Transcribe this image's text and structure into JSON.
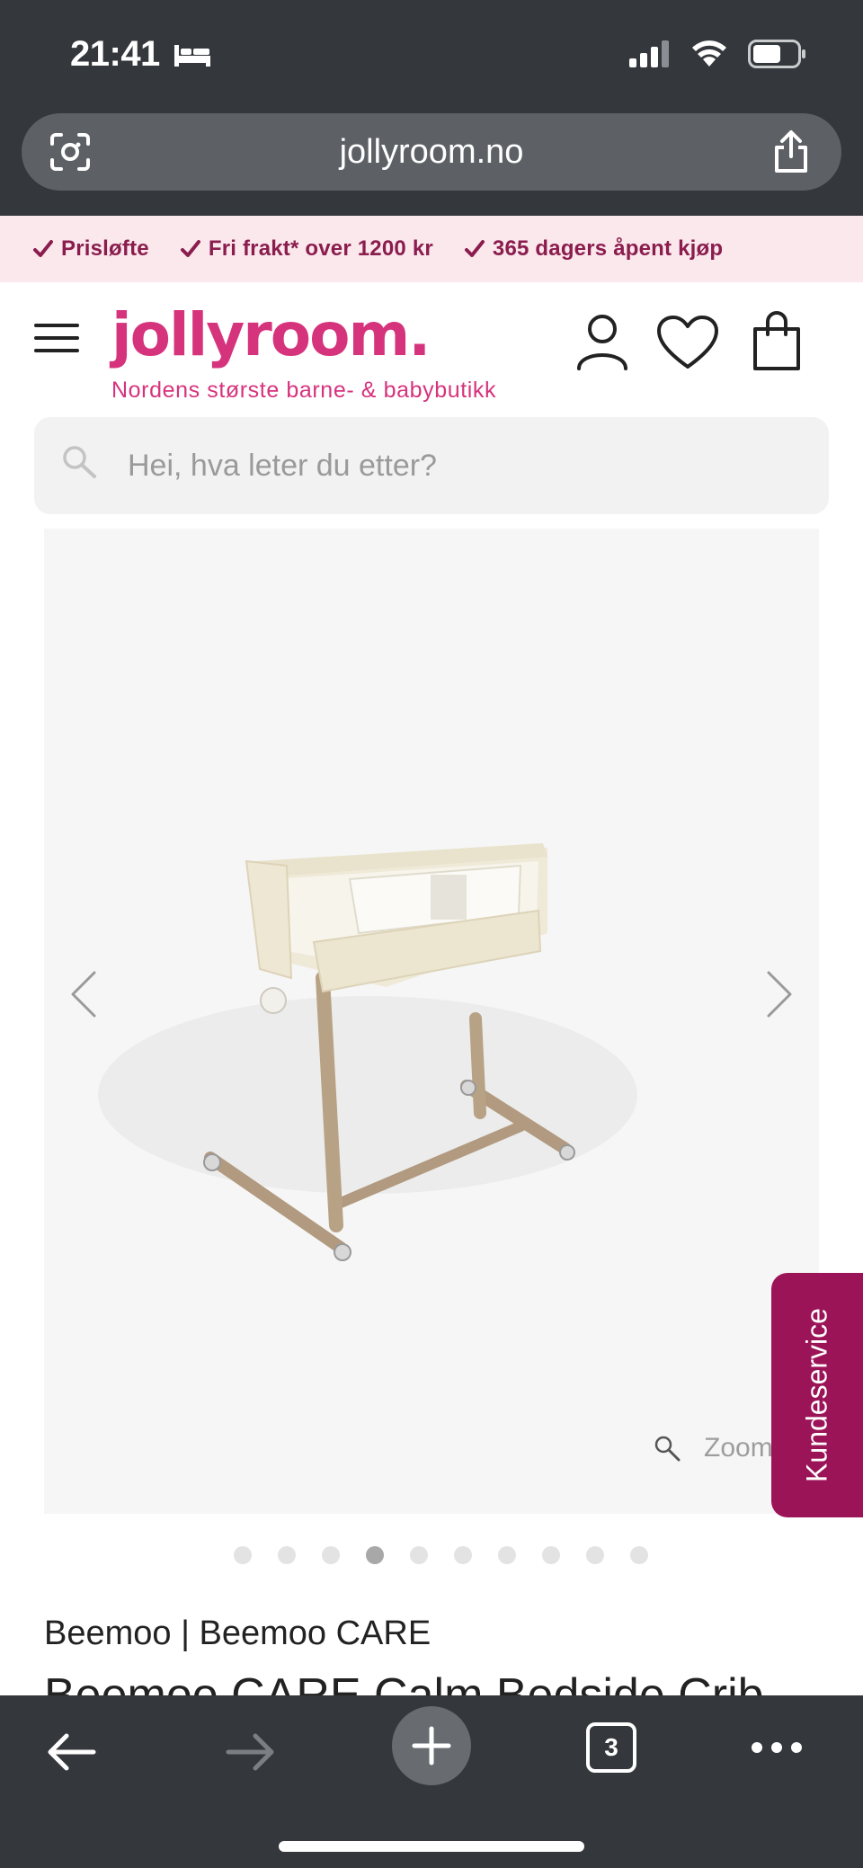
{
  "status_bar": {
    "time": "21:41",
    "icons": [
      "bed-icon",
      "signal-icon",
      "wifi-icon",
      "battery-icon"
    ]
  },
  "browser": {
    "url": "jollyroom.no",
    "tab_count": "3"
  },
  "promo": {
    "items": [
      "Prisløfte",
      "Fri frakt* over 1200 kr",
      "365 dagers åpent kjøp"
    ],
    "color": "#8a1d4e",
    "background": "#fbe8ec"
  },
  "header": {
    "logo": "jollyroom.",
    "tagline": "Nordens største barne- & babybutikk",
    "brand_color": "#d6337d"
  },
  "search": {
    "placeholder": "Hei, hva leter du etter?",
    "value": ""
  },
  "gallery": {
    "zoom_label": "Zoom",
    "image_count": 10,
    "active_index": 3
  },
  "customer_service": {
    "label": "Kundeservice",
    "color": "#9c1458"
  },
  "product": {
    "brand_line": "Beemoo | Beemoo CARE",
    "title": "Beemoo CARE Calm Bedside Crib"
  }
}
